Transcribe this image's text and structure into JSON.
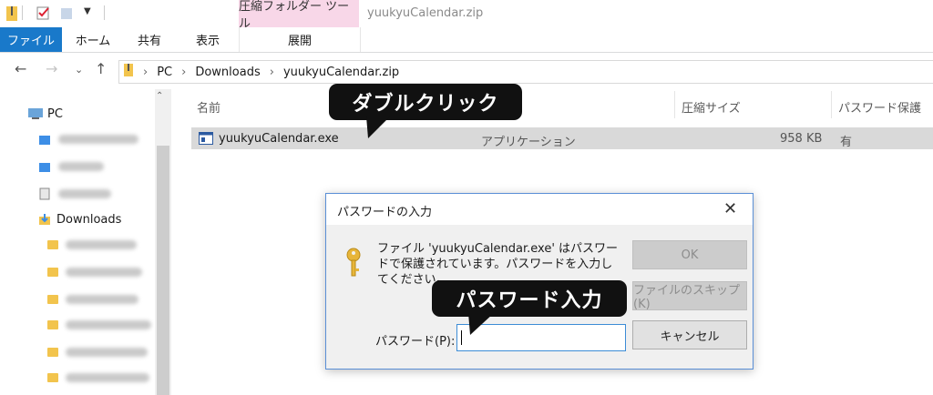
{
  "ribbon": {
    "context_tab_group": "圧縮フォルダー ツール",
    "window_title": "yuukyuCalendar.zip",
    "tabs": [
      "ファイル",
      "ホーム",
      "共有",
      "表示",
      "展開"
    ]
  },
  "address": {
    "path": [
      "PC",
      "Downloads",
      "yuukyuCalendar.zip"
    ]
  },
  "nav_pane": {
    "pc_label": "PC",
    "downloads_label": "Downloads"
  },
  "file_list": {
    "columns": [
      "名前",
      "圧縮サイズ",
      "パスワード保護"
    ],
    "rows": [
      {
        "name": "yuukyuCalendar.exe",
        "type": "アプリケーション",
        "size": "958 KB",
        "protected": "有"
      }
    ]
  },
  "callouts": {
    "double_click": "ダブルクリック",
    "enter_password": "パスワード入力"
  },
  "dialog": {
    "title": "パスワードの入力",
    "message": "ファイル 'yuukyuCalendar.exe' はパスワードで保護されています。パスワードを入力してください。",
    "password_label": "パスワード(P):",
    "password_value": "",
    "buttons": {
      "ok": "OK",
      "skip": "ファイルのスキップ(K)",
      "cancel": "キャンセル"
    }
  },
  "colors": {
    "accent": "#1979ca",
    "context_tab": "#f8d7e8",
    "dialog_border": "#5a8fd6"
  }
}
